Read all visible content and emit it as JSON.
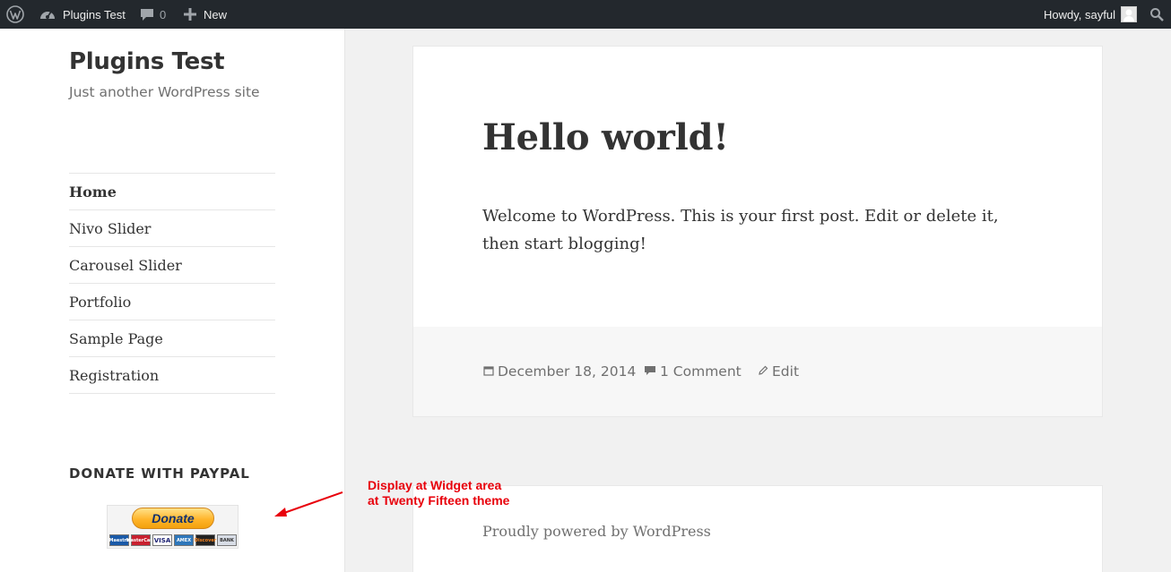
{
  "admin_bar": {
    "site_name": "Plugins Test",
    "comments_count": "0",
    "new_label": "New",
    "howdy": "Howdy, sayful",
    "icons": [
      "wordpress-logo-icon",
      "dashboard-icon",
      "comment-bubble-icon",
      "plus-icon",
      "avatar",
      "search-icon"
    ]
  },
  "sidebar": {
    "site_title": "Plugins Test",
    "site_description": "Just another WordPress site",
    "menu": [
      {
        "label": "Home",
        "current": true
      },
      {
        "label": "Nivo Slider"
      },
      {
        "label": "Carousel Slider"
      },
      {
        "label": "Portfolio"
      },
      {
        "label": "Sample Page"
      },
      {
        "label": "Registration"
      }
    ],
    "widget_title": "DONATE WITH PAYPAL",
    "donate": {
      "button_label": "Donate",
      "cards": [
        "Maestro",
        "MasterCard",
        "VISA",
        "AMEX",
        "Discover",
        "BANK"
      ]
    }
  },
  "post": {
    "title": "Hello world!",
    "content": "Welcome to WordPress. This is your first post. Edit or delete it, then start blogging!",
    "date": "December 18, 2014",
    "comments": "1 Comment",
    "edit": "Edit"
  },
  "footer": {
    "site_info": "Proudly powered by WordPress"
  },
  "annotation": {
    "line1": "Display at Widget area",
    "line2": "at Twenty Fifteen theme",
    "color": "#e8000b"
  },
  "colors": {
    "admin_bar": "#23282d",
    "page_background": "#f1f1f1",
    "panel": "#ffffff",
    "footer_meta": "#f7f7f7"
  }
}
